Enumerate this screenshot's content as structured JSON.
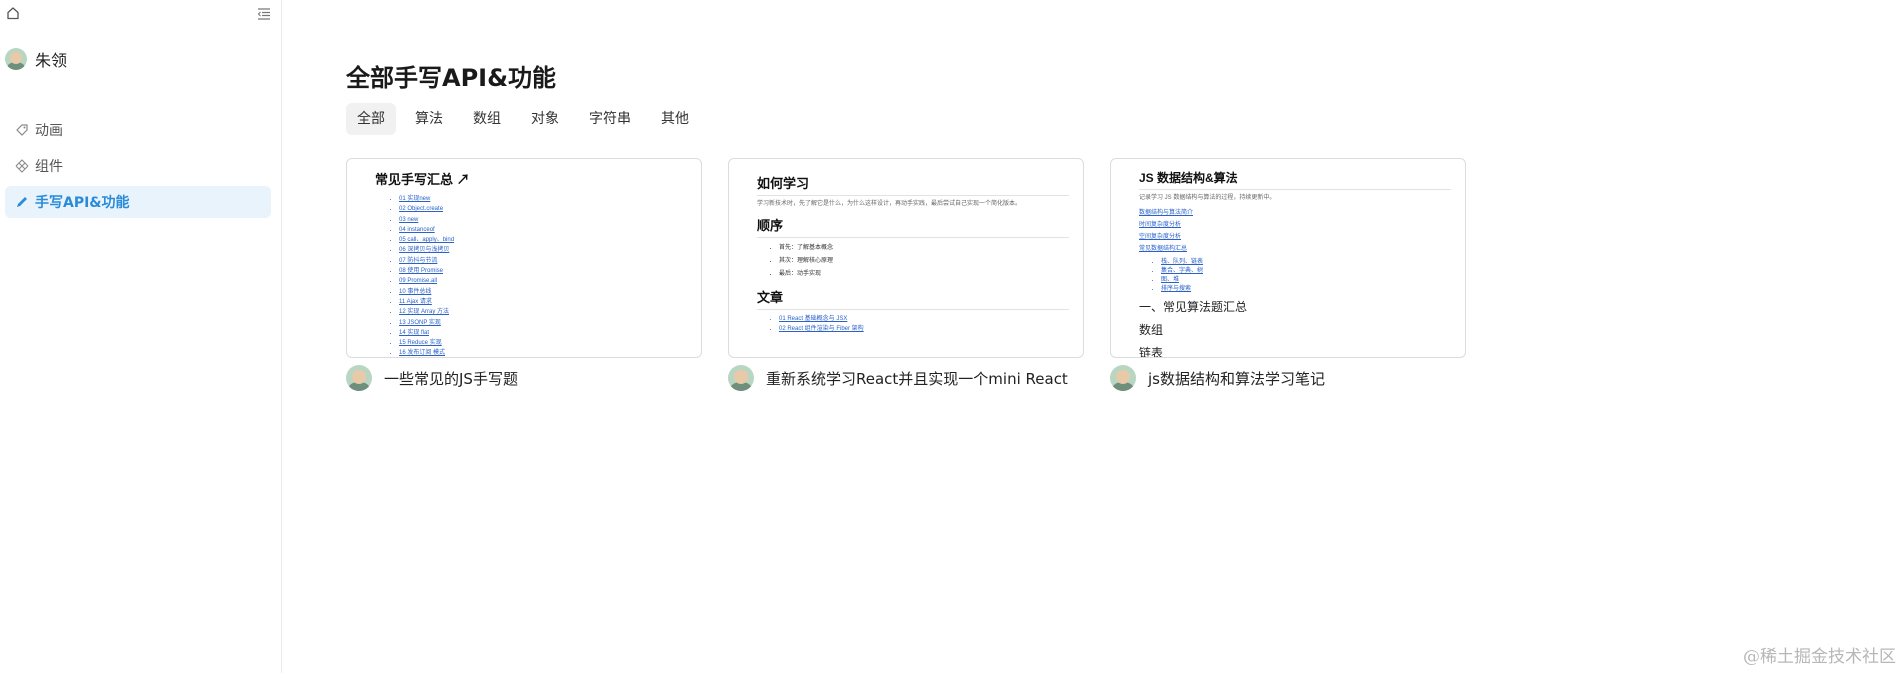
{
  "user": {
    "name": "朱领"
  },
  "nav": [
    {
      "label": "动画",
      "icon": "tag-icon",
      "active": false
    },
    {
      "label": "组件",
      "icon": "component-icon",
      "active": false
    },
    {
      "label": "手写API&功能",
      "icon": "pen-icon",
      "active": true
    }
  ],
  "page": {
    "title": "全部手写API&功能"
  },
  "tabs": [
    "全部",
    "算法",
    "数组",
    "对象",
    "字符串",
    "其他"
  ],
  "active_tab": "全部",
  "cards": [
    {
      "title": "一些常见的JS手写题",
      "thumb": {
        "heading": "常见手写汇总 ↗",
        "links": [
          "01 实现new",
          "02 Object.create",
          "03 new",
          "04 instanceof",
          "05 call、apply、bind",
          "06 深拷贝与浅拷贝",
          "07 防抖与节流",
          "08 使用 Promise",
          "09 Promise.all",
          "10 事件总线",
          "11 Ajax 请求",
          "12 实现 Array 方法",
          "13 JSONP 实现",
          "14 实现 flat",
          "15 Reduce 实现",
          "16 发布订阅 模式"
        ]
      }
    },
    {
      "title": "重新系统学习React并且实现一个mini React",
      "thumb": {
        "heading": "如何学习",
        "para": "学习新技术时，先了解它是什么，为什么这样设计，再动手实践，最后尝试自己实现一个简化版本。",
        "h2_order": "顺序",
        "order": [
          "首先：了解基本概念",
          "其次：理解核心原理",
          "最后：动手实现"
        ],
        "h2_article": "文章",
        "articles": [
          "01 React 基础概念与 JSX",
          "02 React 组件渲染与 Fiber 架构"
        ]
      }
    },
    {
      "title": "js数据结构和算法学习笔记",
      "thumb": {
        "heading": "JS 数据结构&算法",
        "para": "记录学习 JS 数据结构与算法的过程，持续更新中。",
        "links": [
          "数据结构与算法简介",
          "时间复杂度分析",
          "空间复杂度分析",
          "常见数据结构汇总"
        ],
        "list": [
          "栈、队列、链表",
          "集合、字典、树",
          "图、堆",
          "排序与搜索"
        ],
        "section": "一、常见算法题汇总",
        "subs": [
          "数组",
          "链表"
        ]
      }
    }
  ],
  "watermark": "@稀土掘金技术社区"
}
